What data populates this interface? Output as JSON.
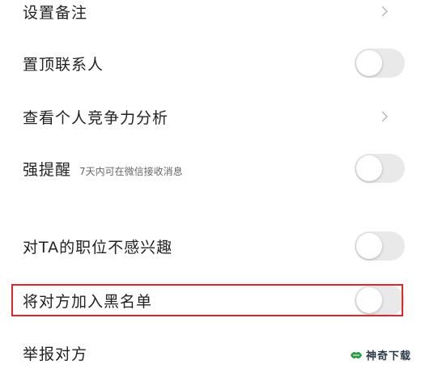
{
  "rows": [
    {
      "label": "设置备注",
      "control": "chevron"
    },
    {
      "label": "置顶联系人",
      "control": "toggle",
      "on": false
    },
    {
      "label": "查看个人竞争力分析",
      "control": "chevron"
    },
    {
      "label": "强提醒",
      "sublabel": "7天内可在微信接收消息",
      "control": "toggle",
      "on": false
    },
    {
      "label": "对TA的职位不感兴趣",
      "control": "toggle",
      "on": false
    },
    {
      "label": "将对方加入黑名单",
      "control": "toggle",
      "on": false
    },
    {
      "label": "举报对方",
      "control": "none"
    }
  ],
  "watermark": {
    "text": "神奇下载",
    "icon": "leaf-logo-icon"
  },
  "colors": {
    "toggle_off": "#e9e9e9",
    "highlight": "#e0262b",
    "chevron": "#b5b5b5"
  }
}
